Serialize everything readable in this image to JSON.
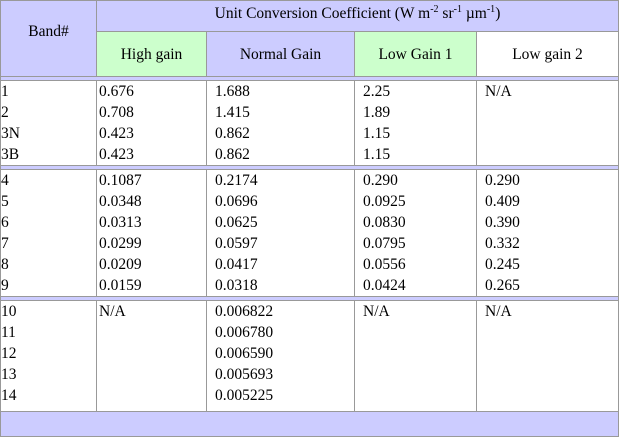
{
  "header": {
    "band": "Band#",
    "unit_title": "Unit Conversion Coefficient (W m",
    "unit_sup1": "-2",
    "unit_mid1": " sr",
    "unit_sup2": "-1",
    "unit_mid2": " µm",
    "unit_sup3": "-1",
    "unit_end": ")",
    "columns": [
      "High gain",
      "Normal Gain",
      "Low Gain 1",
      "Low gain 2"
    ]
  },
  "groups": [
    {
      "bands": [
        "1",
        "2",
        "3N",
        "3B"
      ],
      "high": [
        "0.676",
        "0.708",
        "0.423",
        "0.423"
      ],
      "normal": [
        "1.688",
        "1.415",
        "0.862",
        "0.862"
      ],
      "low1": [
        "2.25",
        "1.89",
        "1.15",
        "1.15"
      ],
      "low2": [
        "N/A"
      ]
    },
    {
      "bands": [
        "4",
        "5",
        "6",
        "7",
        "8",
        "9"
      ],
      "high": [
        "0.1087",
        "0.0348",
        "0.0313",
        "0.0299",
        "0.0209",
        "0.0159"
      ],
      "normal": [
        "0.2174",
        "0.0696",
        "0.0625",
        "0.0597",
        "0.0417",
        "0.0318"
      ],
      "low1": [
        "0.290",
        "0.0925",
        "0.0830",
        "0.0795",
        "0.0556",
        "0.0424"
      ],
      "low2": [
        "0.290",
        "0.409",
        "0.390",
        "0.332",
        "0.245",
        "0.265"
      ]
    },
    {
      "bands": [
        "10",
        "11",
        "12",
        "13",
        "14"
      ],
      "high": [
        "N/A"
      ],
      "normal": [
        "0.006822",
        "0.006780",
        "0.006590",
        "0.005693",
        "0.005225"
      ],
      "low1": [
        "N/A"
      ],
      "low2": [
        "N/A"
      ]
    }
  ]
}
